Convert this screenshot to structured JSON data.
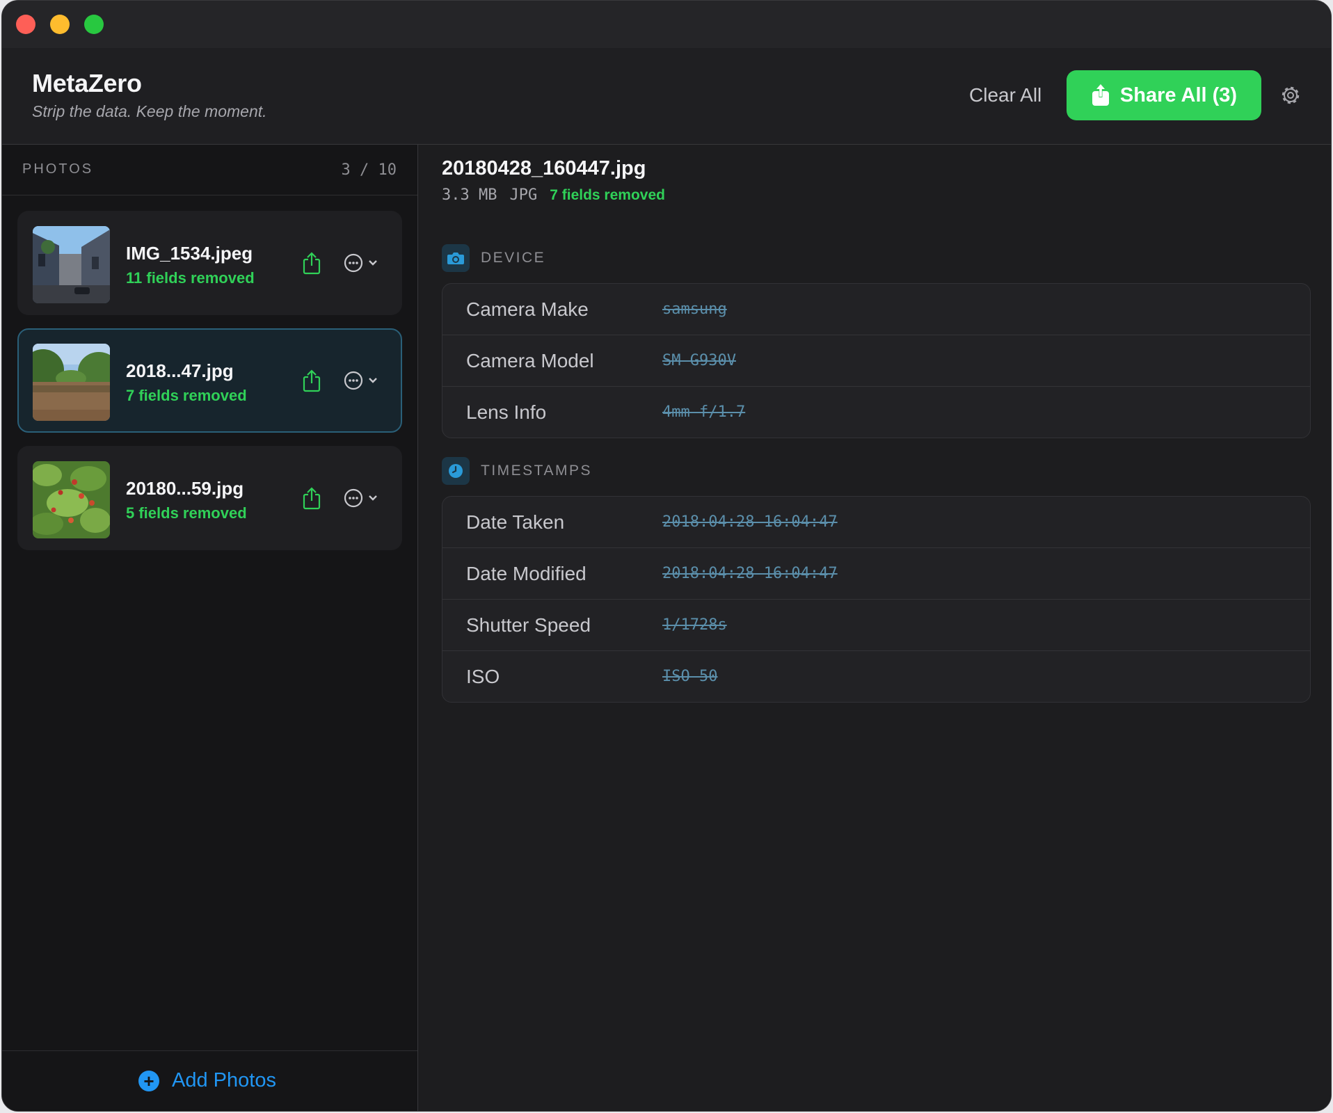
{
  "app": {
    "title": "MetaZero",
    "subtitle": "Strip the data. Keep the moment."
  },
  "toolbar": {
    "clear_all_label": "Clear All",
    "share_all_label": "Share All (3)",
    "accent_color": "#30d158"
  },
  "sidebar": {
    "title": "PHOTOS",
    "count": "3 / 10",
    "photos": [
      {
        "name": "IMG_1534.jpeg",
        "fields_removed": "11 fields removed",
        "thumbnail": "street-photo",
        "selected": false
      },
      {
        "name": "2018...47.jpg",
        "fields_removed": "7 fields removed",
        "thumbnail": "river-photo",
        "selected": true
      },
      {
        "name": "20180...59.jpg",
        "fields_removed": "5 fields removed",
        "thumbnail": "foliage-photo",
        "selected": false
      }
    ],
    "add_photos_label": "Add Photos",
    "add_color": "#2196f3"
  },
  "detail": {
    "file_name": "20180428_160447.jpg",
    "size": "3.3 MB",
    "format": "JPG",
    "fields_removed": "7 fields removed",
    "sections": [
      {
        "title": "DEVICE",
        "icon": "camera-icon",
        "rows": [
          {
            "label": "Camera Make",
            "value": "samsung"
          },
          {
            "label": "Camera Model",
            "value": "SM-G930V"
          },
          {
            "label": "Lens Info",
            "value": "4mm f/1.7"
          }
        ]
      },
      {
        "title": "TIMESTAMPS",
        "icon": "clock-icon",
        "rows": [
          {
            "label": "Date Taken",
            "value": "2018:04:28 16:04:47"
          },
          {
            "label": "Date Modified",
            "value": "2018:04:28 16:04:47"
          },
          {
            "label": "Shutter Speed",
            "value": "1/1728s"
          },
          {
            "label": "ISO",
            "value": "ISO 50"
          }
        ]
      }
    ]
  }
}
